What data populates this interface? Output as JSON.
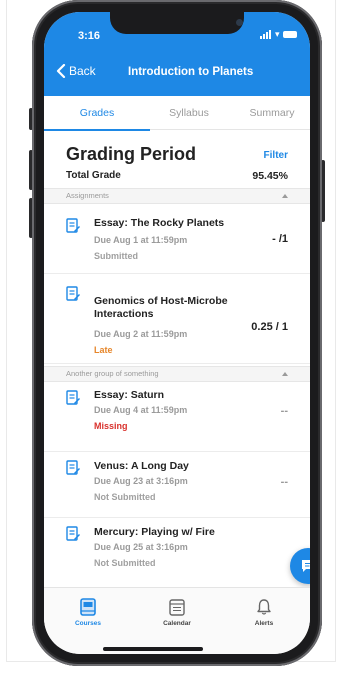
{
  "status_bar": {
    "time": "3:16"
  },
  "nav": {
    "back_label": "Back",
    "title": "Introduction to Planets"
  },
  "tabs": [
    {
      "label": "Grades",
      "active": true
    },
    {
      "label": "Syllabus",
      "active": false
    },
    {
      "label": "Summary",
      "active": false
    }
  ],
  "grading": {
    "title": "Grading Period",
    "filter_label": "Filter",
    "total_label": "Total Grade",
    "total_value": "95.45%"
  },
  "groups": [
    {
      "name": "Assignments",
      "items": [
        {
          "title": "Essay: The Rocky Planets",
          "due": "Due Aug 1 at 11:59pm",
          "status": "Submitted",
          "score": "- /1"
        },
        {
          "title": "Genomics of Host-Microbe Interactions",
          "due": "Due Aug 2 at 11:59pm",
          "status": "Late",
          "score": "0.25 / 1"
        }
      ]
    },
    {
      "name": "Another group of something",
      "items": [
        {
          "title": "Essay: Saturn",
          "due": "Due Aug 4 at 11:59pm",
          "status": "Missing",
          "score": "--"
        },
        {
          "title": "Venus: A Long Day",
          "due": "Due Aug 23 at 3:16pm",
          "status": "Not Submitted",
          "score": "--"
        },
        {
          "title": "Mercury: Playing w/ Fire",
          "due": "Due Aug 25 at 3:16pm",
          "status": "Not Submitted",
          "score": ""
        }
      ]
    }
  ],
  "bottom_nav": [
    {
      "label": "Courses",
      "icon": "courses-icon",
      "active": true
    },
    {
      "label": "Calendar",
      "icon": "calendar-icon",
      "active": false
    },
    {
      "label": "Alerts",
      "icon": "bell-icon",
      "active": false
    }
  ],
  "colors": {
    "accent": "#1e88e5",
    "late": "#e6862a",
    "missing": "#d9312c"
  }
}
